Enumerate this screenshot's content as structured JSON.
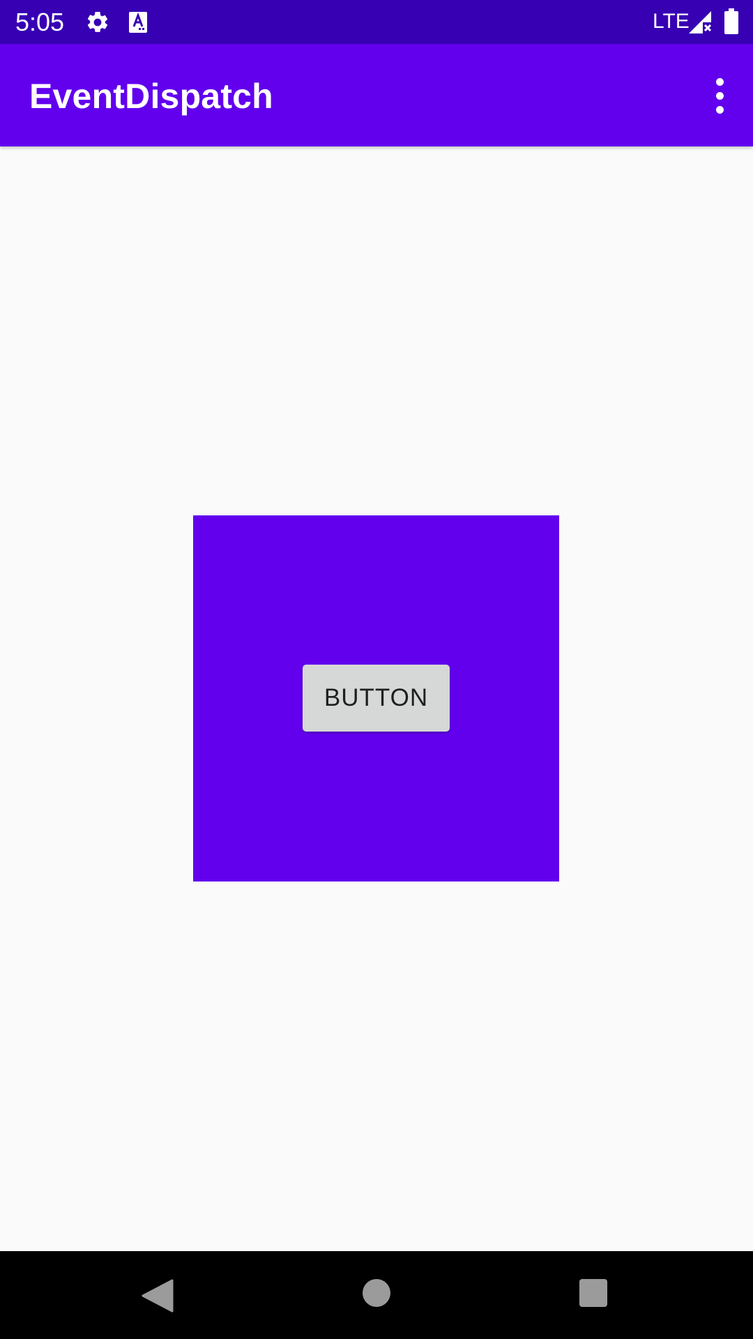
{
  "status_bar": {
    "time": "5:05",
    "network": "LTE",
    "icons": [
      "gear-icon",
      "text-a-icon",
      "signal-icon",
      "battery-icon"
    ]
  },
  "app_bar": {
    "title": "EventDispatch",
    "overflow_icon": "more-vert-icon"
  },
  "content": {
    "button_label": "BUTTON"
  },
  "nav_bar": {
    "icons": [
      "back-icon",
      "home-icon",
      "recents-icon"
    ]
  },
  "colors": {
    "status_bar": "#3700b3",
    "primary": "#6200ee",
    "background": "#fafafa",
    "button": "#d6d7d7",
    "nav_bar": "#000000"
  }
}
